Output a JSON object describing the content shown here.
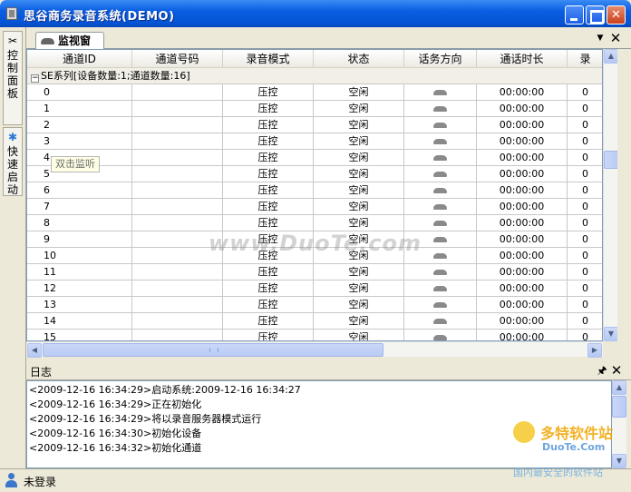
{
  "window": {
    "title": "思谷商务录音系统(DEMO)"
  },
  "left_panel": {
    "tabs": [
      {
        "label": "控制面板",
        "icon": "tools-icon"
      },
      {
        "label": "快速启动",
        "icon": "gear-icon"
      }
    ]
  },
  "doc_tab": {
    "label": "监视窗"
  },
  "grid": {
    "columns": [
      "通道ID",
      "通道号码",
      "录音模式",
      "状态",
      "话务方向",
      "通话时长",
      "录"
    ],
    "group_label": "SE系列[设备数量:1;通道数量:16]",
    "rows": [
      {
        "id": "0",
        "number": "",
        "mode": "压控",
        "state": "空闲",
        "duration": "00:00:00",
        "extra": "0"
      },
      {
        "id": "1",
        "number": "",
        "mode": "压控",
        "state": "空闲",
        "duration": "00:00:00",
        "extra": "0"
      },
      {
        "id": "2",
        "number": "",
        "mode": "压控",
        "state": "空闲",
        "duration": "00:00:00",
        "extra": "0"
      },
      {
        "id": "3",
        "number": "",
        "mode": "压控",
        "state": "空闲",
        "duration": "00:00:00",
        "extra": "0"
      },
      {
        "id": "4",
        "number": "",
        "mode": "压控",
        "state": "空闲",
        "duration": "00:00:00",
        "extra": "0"
      },
      {
        "id": "5",
        "number": "",
        "mode": "压控",
        "state": "空闲",
        "duration": "00:00:00",
        "extra": "0"
      },
      {
        "id": "6",
        "number": "",
        "mode": "压控",
        "state": "空闲",
        "duration": "00:00:00",
        "extra": "0"
      },
      {
        "id": "7",
        "number": "",
        "mode": "压控",
        "state": "空闲",
        "duration": "00:00:00",
        "extra": "0"
      },
      {
        "id": "8",
        "number": "",
        "mode": "压控",
        "state": "空闲",
        "duration": "00:00:00",
        "extra": "0"
      },
      {
        "id": "9",
        "number": "",
        "mode": "压控",
        "state": "空闲",
        "duration": "00:00:00",
        "extra": "0"
      },
      {
        "id": "10",
        "number": "",
        "mode": "压控",
        "state": "空闲",
        "duration": "00:00:00",
        "extra": "0"
      },
      {
        "id": "11",
        "number": "",
        "mode": "压控",
        "state": "空闲",
        "duration": "00:00:00",
        "extra": "0"
      },
      {
        "id": "12",
        "number": "",
        "mode": "压控",
        "state": "空闲",
        "duration": "00:00:00",
        "extra": "0"
      },
      {
        "id": "13",
        "number": "",
        "mode": "压控",
        "state": "空闲",
        "duration": "00:00:00",
        "extra": "0"
      },
      {
        "id": "14",
        "number": "",
        "mode": "压控",
        "state": "空闲",
        "duration": "00:00:00",
        "extra": "0"
      },
      {
        "id": "15",
        "number": "",
        "mode": "压控",
        "state": "空闲",
        "duration": "00:00:00",
        "extra": "0"
      }
    ]
  },
  "tooltip": {
    "text": "双击监听"
  },
  "log": {
    "title": "日志",
    "lines": [
      "<2009-12-16 16:34:29>启动系统:2009-12-16 16:34:27",
      "<2009-12-16 16:34:29>正在初始化",
      "<2009-12-16 16:34:29>将以录音服务器模式运行",
      "<2009-12-16 16:34:30>初始化设备",
      "<2009-12-16 16:34:32>初始化通道"
    ]
  },
  "status": {
    "user_text": "未登录"
  },
  "watermark": {
    "center": "www.DuoTe.com",
    "brand": "多特软件站",
    "url": "DuoTe.Com",
    "slogan": "国内最安全的软件站"
  },
  "colors": {
    "titlebar": "#0a5ee0",
    "grid_border": "#7f9db9",
    "scrollbar": "#c9d7f7"
  }
}
